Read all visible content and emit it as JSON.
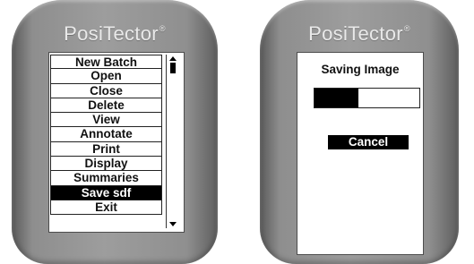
{
  "devices": [
    {
      "brand": "PosiTector",
      "brand_mark": "®",
      "menu": {
        "items": [
          "New Batch",
          "Open",
          "Close",
          "Delete",
          "View",
          "Annotate",
          "Print",
          "Display",
          "Summaries",
          "Save sdf",
          "Exit"
        ],
        "selected": "Save sdf",
        "scroll_position": 0.05
      }
    },
    {
      "brand": "PosiTector",
      "brand_mark": "®",
      "dialog": {
        "title": "Saving Image",
        "progress": 0.42,
        "cancel_label": "Cancel"
      }
    }
  ],
  "colors": {
    "device_body": "#9d9d9d",
    "brand_text": "#e9e9e9",
    "selected_bg": "#000000",
    "selected_text": "#ffffff"
  }
}
